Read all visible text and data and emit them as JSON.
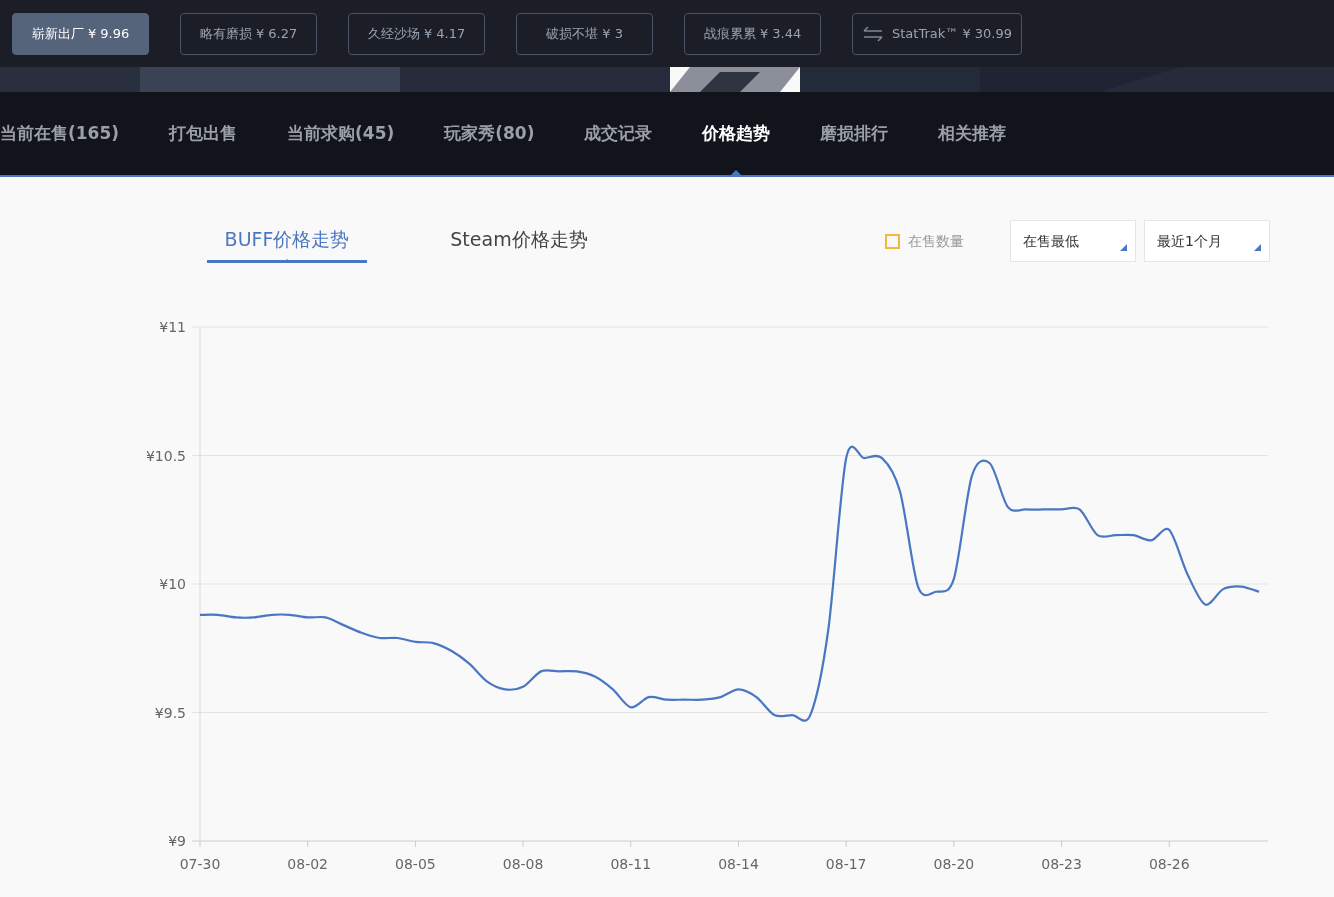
{
  "wear_buttons": [
    {
      "label": "崭新出厂 ¥ 9.96",
      "selected": true,
      "kind": "plain"
    },
    {
      "label": "略有磨损 ¥ 6.27",
      "selected": false,
      "kind": "plain"
    },
    {
      "label": "久经沙场 ¥ 4.17",
      "selected": false,
      "kind": "plain"
    },
    {
      "label": "破损不堪 ¥ 3",
      "selected": false,
      "kind": "plain"
    },
    {
      "label": "战痕累累 ¥ 3.44",
      "selected": false,
      "kind": "plain"
    },
    {
      "label": "StatTrak™ ¥ 30.99",
      "selected": false,
      "kind": "swap"
    }
  ],
  "nav_tabs": [
    {
      "label": "当前在售(165)",
      "selected": false
    },
    {
      "label": "打包出售",
      "selected": false
    },
    {
      "label": "当前求购(45)",
      "selected": false
    },
    {
      "label": "玩家秀(80)",
      "selected": false
    },
    {
      "label": "成交记录",
      "selected": false
    },
    {
      "label": "价格趋势",
      "selected": true
    },
    {
      "label": "磨损排行",
      "selected": false
    },
    {
      "label": "相关推荐",
      "selected": false
    }
  ],
  "chart_tabs": [
    {
      "label": "BUFF价格走势",
      "selected": true
    },
    {
      "label": "Steam价格走势",
      "selected": false
    }
  ],
  "on_sale_count": {
    "label": "在售数量",
    "checked": false
  },
  "dropdowns": [
    {
      "value": "在售最低"
    },
    {
      "value": "最近1个月"
    }
  ],
  "chart": {
    "chart_data": {
      "type": "line",
      "grid": true,
      "ylim": [
        9,
        11
      ],
      "categories": [
        "07-30",
        null,
        null,
        null,
        null,
        null,
        "08-02",
        null,
        null,
        null,
        null,
        null,
        "08-05",
        null,
        null,
        null,
        null,
        null,
        "08-08",
        null,
        null,
        null,
        null,
        null,
        "08-11",
        null,
        null,
        null,
        null,
        null,
        "08-14",
        null,
        null,
        null,
        null,
        null,
        "08-17",
        null,
        null,
        null,
        null,
        null,
        "08-20",
        null,
        null,
        null,
        null,
        null,
        "08-23",
        null,
        null,
        null,
        null,
        null,
        "08-26",
        null,
        null,
        null,
        null,
        null
      ],
      "series": [
        {
          "color": "#4a77c2",
          "values": [
            9.88,
            9.88,
            9.87,
            9.87,
            9.88,
            9.88,
            9.87,
            9.87,
            9.84,
            9.81,
            9.79,
            9.79,
            9.775,
            9.77,
            9.74,
            9.69,
            9.62,
            9.59,
            9.6,
            9.66,
            9.66,
            9.66,
            9.64,
            9.59,
            9.52,
            9.56,
            9.55,
            9.55,
            9.55,
            9.56,
            9.59,
            9.56,
            9.49,
            9.49,
            9.49,
            9.82,
            10.49,
            10.49,
            10.49,
            10.36,
            9.99,
            9.97,
            10.02,
            10.42,
            10.47,
            10.3,
            10.29,
            10.29,
            10.29,
            10.29,
            10.19,
            10.19,
            10.19,
            10.17,
            10.21,
            10.04,
            9.92,
            9.98,
            9.99,
            9.97
          ]
        }
      ],
      "yticks": [
        {
          "value": 9,
          "label": "¥9"
        },
        {
          "value": 9.5,
          "label": "¥9.5"
        },
        {
          "value": 10,
          "label": "¥10"
        },
        {
          "value": 10.5,
          "label": "¥10.5"
        },
        {
          "value": 11,
          "label": "¥11"
        }
      ]
    }
  }
}
